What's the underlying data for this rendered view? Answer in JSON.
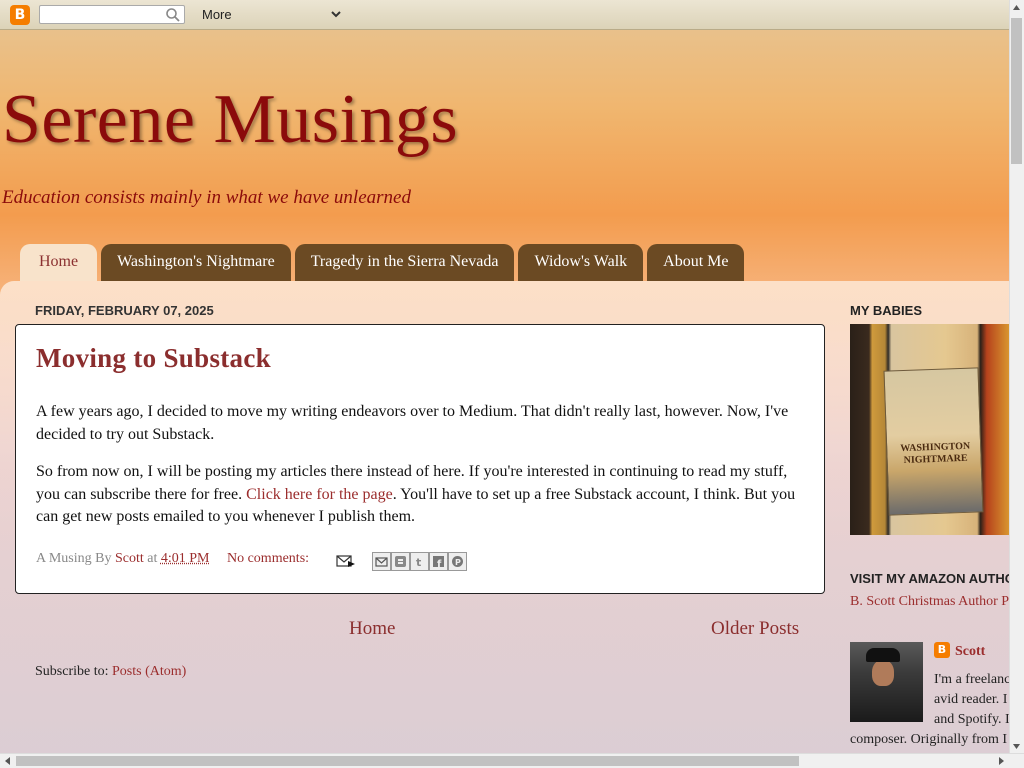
{
  "navbar": {
    "logo_letter": "B",
    "search_placeholder": "",
    "more_label": "More"
  },
  "header": {
    "title": "Serene Musings",
    "description": "Education consists mainly in what we have unlearned"
  },
  "tabs": [
    {
      "label": "Home",
      "active": true
    },
    {
      "label": "Washington's Nightmare",
      "active": false
    },
    {
      "label": "Tragedy in the Sierra Nevada",
      "active": false
    },
    {
      "label": "Widow's Walk",
      "active": false
    },
    {
      "label": "About Me",
      "active": false
    }
  ],
  "post": {
    "date": "FRIDAY, FEBRUARY 07, 2025",
    "title": "Moving to Substack",
    "p1": "A few years ago, I decided to move my writing endeavors over to Medium. That didn't really last, however. Now, I've decided to try out Substack.",
    "p2_before": "So from now on, I will be posting my articles there instead of here. If you're interested in continuing to read my stuff, you can subscribe there for free. ",
    "p2_link": "Click here for the page",
    "p2_after": ". You'll have to set up a free Substack account, I think. But you can get new posts emailed to you whenever I publish them.",
    "footer_prefix": "A Musing By",
    "author": "Scott",
    "at": "at",
    "time": "4:01 PM",
    "comments": "No comments:"
  },
  "pager": {
    "home": "Home",
    "older": "Older Posts"
  },
  "subscribe": {
    "label": "Subscribe to:",
    "link": "Posts (Atom)"
  },
  "sidebar": {
    "heading1": "MY BABIES",
    "book_title": "WASHINGTON NIGHTMARE",
    "heading2": "VISIT MY AMAZON AUTHO",
    "amazon_link": "B. Scott Christmas Author P",
    "profile_name": "Scott",
    "profile_lines": [
      "I'm a freelanc",
      "avid reader. I",
      "and Spotify. I",
      "composer. Originally from I"
    ]
  },
  "colors": {
    "title": "#8b0b0b",
    "link": "#9b2d2d",
    "tab": "#6b4a23",
    "tab_active": "#f8e3cb",
    "blogger_orange": "#f57d00"
  }
}
